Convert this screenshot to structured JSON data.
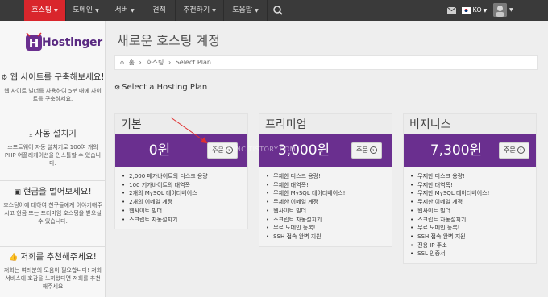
{
  "nav": {
    "items": [
      {
        "label": "호스팅",
        "active": true
      },
      {
        "label": "도메인",
        "active": false
      },
      {
        "label": "서버",
        "active": false
      },
      {
        "label": "견적",
        "active": false
      },
      {
        "label": "추천하기",
        "active": false
      },
      {
        "label": "도움말",
        "active": false
      }
    ],
    "language": "KO",
    "icons": {
      "search": "search-icon",
      "mail": "mail-icon",
      "flag": "korea-flag-icon"
    }
  },
  "sidebar": {
    "logo": "Hostinger",
    "blocks": [
      {
        "title": "웹 사이트를 구축해보세요!",
        "icon": "gears-icon",
        "text": "웹 사이트 빌더를 사용하여 5분 내에 사이트를 구축하세요."
      },
      {
        "title": "자동 설치기",
        "icon": "download-icon",
        "text": "소프트웨어 자동 설치기로 100여 개의 PHP 어플리케이션을 인스톨할 수 있습니다."
      },
      {
        "title": "현금을 벌어보세요!",
        "icon": "money-icon",
        "text": "호스팅어에 대하여 친구들에게 이야기해주시고 현금 또는 프리미엄 호스팅을 받으실 수 있습니다."
      },
      {
        "title": "저희를 추천해주세요!",
        "icon": "thumbs-up-icon",
        "text": "저희는 여러분의 도움이 필요합니다! 저희 서비스에 호감을 느끼셨다면 저희를 추천해주세요"
      }
    ]
  },
  "main": {
    "title": "새로운 호스팅 계정",
    "breadcrumb": [
      "홈",
      "호스팅",
      "Select Plan"
    ],
    "section_title": "Select a Hosting Plan"
  },
  "plans": [
    {
      "name": "기본",
      "price": "0원",
      "order_label": "주문",
      "features": [
        "2,000 메가바이트의 디스크 용량",
        "100 기가바이트의 대역폭",
        "2개의 MySQL 데이터베이스",
        "2개의 이메일 계정",
        "웹사이트 빌더",
        "스크립트 자동설치기"
      ]
    },
    {
      "name": "프리미엄",
      "price": "3,000원",
      "order_label": "주문",
      "features": [
        "무제한 디스크 용량!",
        "무제한 대역폭!",
        "무제한 MySQL 데이터베이스!",
        "무제한 이메일 계정",
        "웹사이트 빌더",
        "스크립트 자동설치기",
        "무료 도메인 등록!",
        "SSH 접속 완벽 지원"
      ]
    },
    {
      "name": "비지니스",
      "price": "7,300원",
      "order_label": "주문",
      "features": [
        "무제한 디스크 용량!",
        "무제한 대역폭!",
        "무제한 MySQL 데이터베이스!",
        "무제한 이메일 계정",
        "웹사이트 빌더",
        "스크립트 자동설치기",
        "무료 도메인 등록!",
        "SSH 접속 완벽 지원",
        "전용 IP 주소",
        "SSL 인증서"
      ]
    }
  ],
  "watermark": "WEBSYNC.TISTORY.COM",
  "colors": {
    "nav_bg": "#3a3a3a",
    "nav_active": "#d9262c",
    "plan_bar": "#6a2f8f",
    "arrow": "#e03030"
  }
}
